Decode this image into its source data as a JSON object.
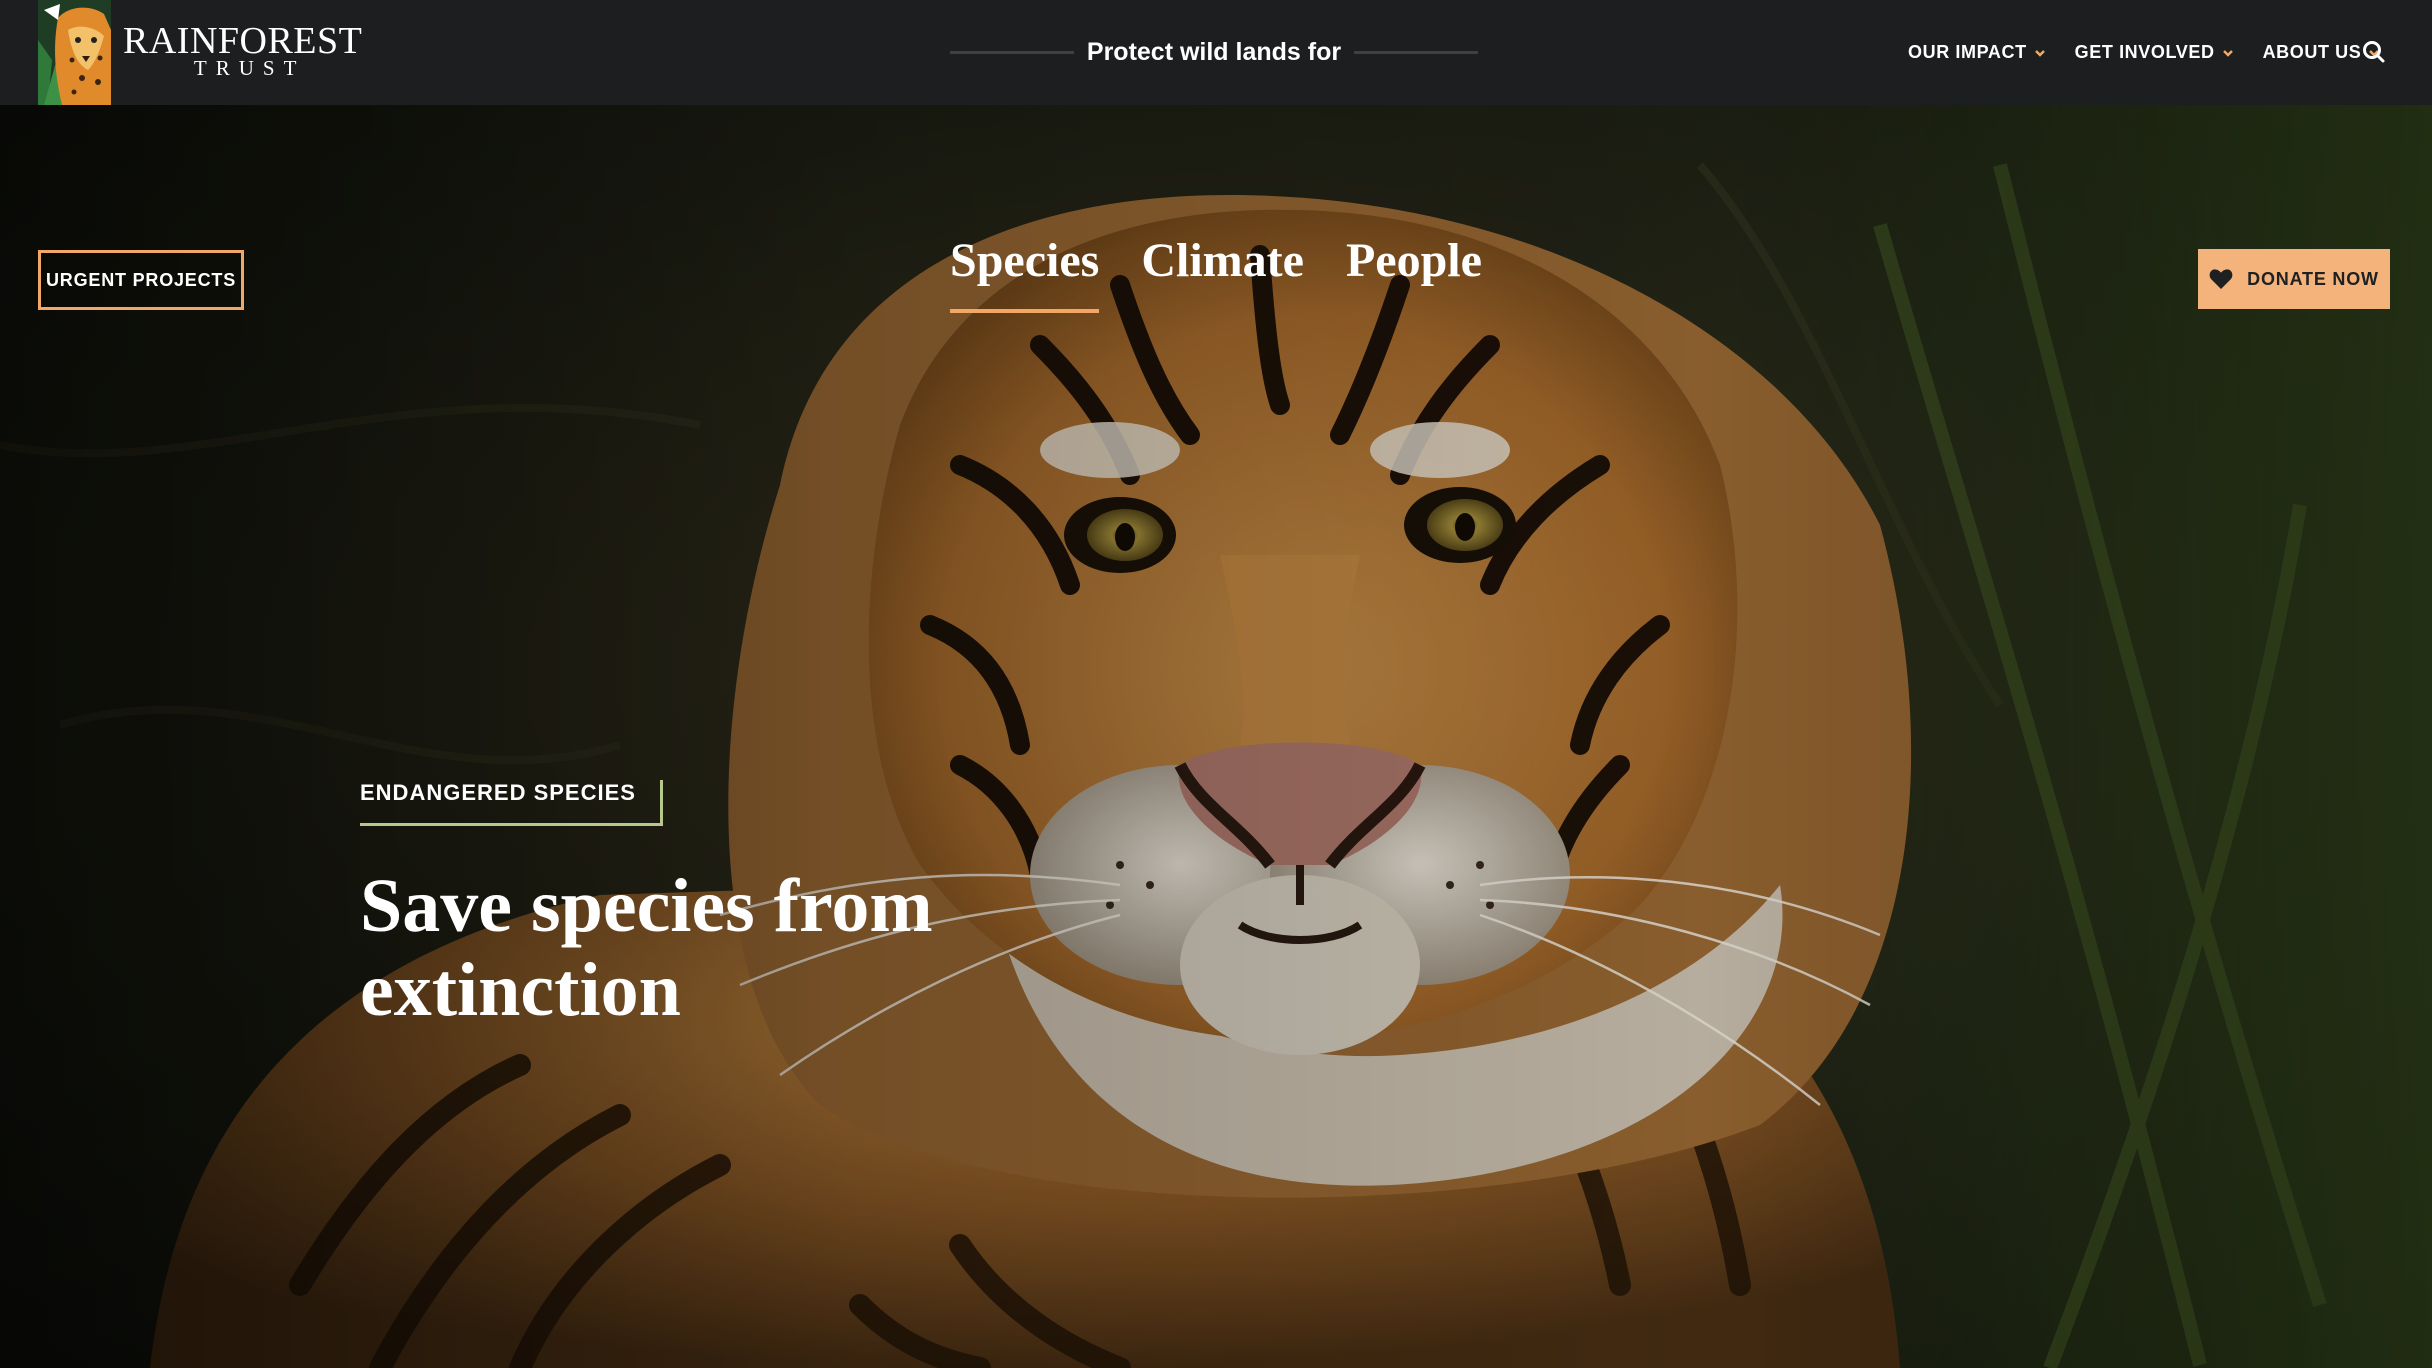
{
  "brand": {
    "name_line1": "RAINFOREST",
    "name_line2": "TRUST",
    "logo_icon": "jaguar-logo-icon"
  },
  "header": {
    "tagline": "Protect wild lands for",
    "nav": [
      {
        "label": "OUR IMPACT",
        "icon": "chevron-down-icon"
      },
      {
        "label": "GET INVOLVED",
        "icon": "chevron-down-icon"
      },
      {
        "label": "ABOUT US",
        "icon": "chevron-down-icon"
      }
    ],
    "search_icon": "search-icon"
  },
  "hero": {
    "urgent_label": "URGENT PROJECTS",
    "tabs": [
      {
        "label": "Species",
        "active": true
      },
      {
        "label": "Climate",
        "active": false
      },
      {
        "label": "People",
        "active": false
      }
    ],
    "donate_label": "DONATE NOW",
    "donate_icon": "heart-icon",
    "eyebrow": "ENDANGERED SPECIES",
    "headline": "Save species from extinction",
    "background": "tiger-photo"
  },
  "colors": {
    "header_bg": "#1c1e1f",
    "accent_orange": "#f2a766",
    "donate_bg": "#f4b37b",
    "eyebrow_green": "#b6c98a"
  }
}
